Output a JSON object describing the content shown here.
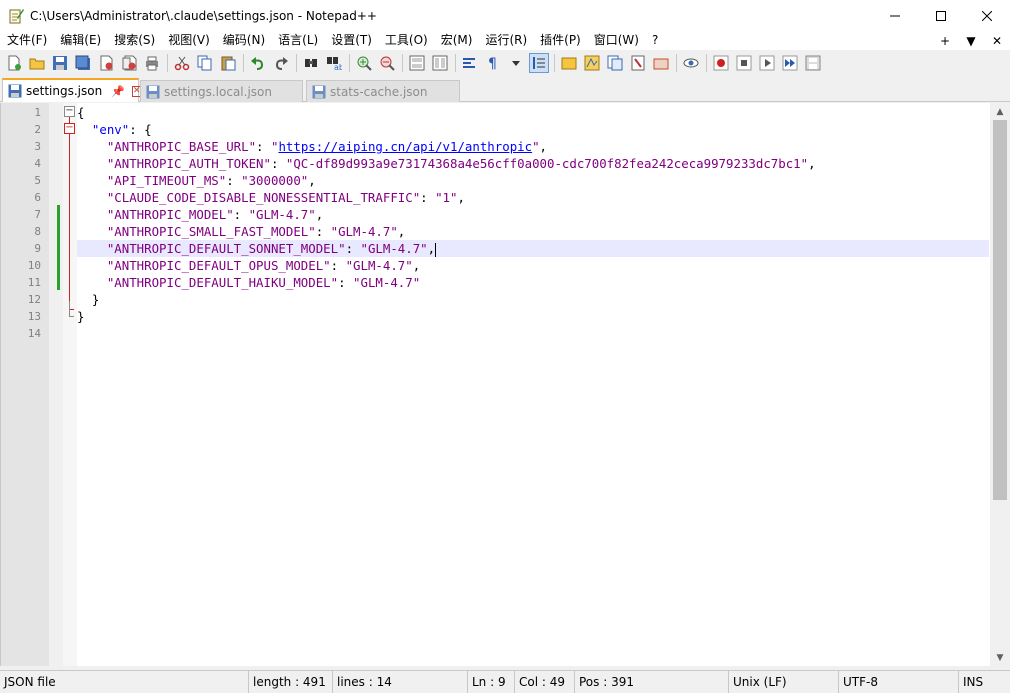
{
  "window": {
    "title": "C:\\Users\\Administrator\\.claude\\settings.json - Notepad++",
    "app_icon": "notepad-icon",
    "controls": [
      "minimize-icon",
      "maximize-icon",
      "close-icon"
    ]
  },
  "menu": {
    "items": [
      "文件(F)",
      "编辑(E)",
      "搜索(S)",
      "视图(V)",
      "编码(N)",
      "语言(L)",
      "设置(T)",
      "工具(O)",
      "宏(M)",
      "运行(R)",
      "插件(P)",
      "窗口(W)",
      "?"
    ],
    "right": [
      "+",
      "▼",
      "✕"
    ]
  },
  "toolbar": {
    "buttons": [
      "new-file-icon",
      "open-file-icon",
      "save-icon",
      "save-all-icon",
      "close-file-icon",
      "close-all-icon",
      "print-icon",
      "cut-icon",
      "copy-icon",
      "paste-icon",
      "undo-icon",
      "redo-icon",
      "find-icon",
      "replace-icon",
      "zoom-in-icon",
      "zoom-out-icon",
      "sync-vertical-icon",
      "sync-horizontal-icon",
      "word-wrap-icon",
      "show-all-chars-icon",
      "indent-guide-icon",
      "dropdown-icon",
      "folder-as-workspace-icon",
      "doc-map-icon",
      "function-list-icon",
      "doc-list-icon",
      "file-browser-icon",
      "monitoring-icon",
      "record-macro-icon",
      "stop-macro-icon",
      "play-macro-icon",
      "run-macro-multiple-icon",
      "save-macro-icon"
    ]
  },
  "tabs": [
    {
      "label": "settings.json",
      "active": true,
      "pin": "📌",
      "close": "✕"
    },
    {
      "label": "settings.local.json",
      "active": false
    },
    {
      "label": "stats-cache.json",
      "active": false
    }
  ],
  "editor": {
    "line_numbers": [
      "1",
      "2",
      "3",
      "4",
      "5",
      "6",
      "7",
      "8",
      "9",
      "10",
      "11",
      "12",
      "13",
      "14"
    ],
    "current_line": 9,
    "lines": [
      [
        {
          "t": "brace",
          "v": "{"
        }
      ],
      [
        {
          "t": "op",
          "v": "  "
        },
        {
          "t": "key2",
          "v": "\"env\""
        },
        {
          "t": "op",
          "v": ": {"
        }
      ],
      [
        {
          "t": "op",
          "v": "    "
        },
        {
          "t": "key",
          "v": "\"ANTHROPIC_BASE_URL\""
        },
        {
          "t": "op",
          "v": ": "
        },
        {
          "t": "str",
          "v": "\""
        },
        {
          "t": "url",
          "v": "https://aiping.cn/api/v1/anthropic"
        },
        {
          "t": "str",
          "v": "\""
        },
        {
          "t": "op",
          "v": ","
        }
      ],
      [
        {
          "t": "op",
          "v": "    "
        },
        {
          "t": "key",
          "v": "\"ANTHROPIC_AUTH_TOKEN\""
        },
        {
          "t": "op",
          "v": ": "
        },
        {
          "t": "str",
          "v": "\"QC-df89d993a9e73174368a4e56cff0a000-cdc700f82fea242ceca9979233dc7bc1\""
        },
        {
          "t": "op",
          "v": ","
        }
      ],
      [
        {
          "t": "op",
          "v": "    "
        },
        {
          "t": "key",
          "v": "\"API_TIMEOUT_MS\""
        },
        {
          "t": "op",
          "v": ": "
        },
        {
          "t": "str",
          "v": "\"3000000\""
        },
        {
          "t": "op",
          "v": ","
        }
      ],
      [
        {
          "t": "op",
          "v": "    "
        },
        {
          "t": "key",
          "v": "\"CLAUDE_CODE_DISABLE_NONESSENTIAL_TRAFFIC\""
        },
        {
          "t": "op",
          "v": ": "
        },
        {
          "t": "str",
          "v": "\"1\""
        },
        {
          "t": "op",
          "v": ","
        }
      ],
      [
        {
          "t": "op",
          "v": "    "
        },
        {
          "t": "key",
          "v": "\"ANTHROPIC_MODEL\""
        },
        {
          "t": "op",
          "v": ": "
        },
        {
          "t": "str",
          "v": "\"GLM-4.7\""
        },
        {
          "t": "op",
          "v": ","
        }
      ],
      [
        {
          "t": "op",
          "v": "    "
        },
        {
          "t": "key",
          "v": "\"ANTHROPIC_SMALL_FAST_MODEL\""
        },
        {
          "t": "op",
          "v": ": "
        },
        {
          "t": "str",
          "v": "\"GLM-4.7\""
        },
        {
          "t": "op",
          "v": ","
        }
      ],
      [
        {
          "t": "op",
          "v": "    "
        },
        {
          "t": "key",
          "v": "\"ANTHROPIC_DEFAULT_SONNET_MODEL\""
        },
        {
          "t": "op",
          "v": ": "
        },
        {
          "t": "str",
          "v": "\"GLM-4.7\""
        },
        {
          "t": "op",
          "v": ","
        },
        {
          "t": "caret",
          "v": ""
        }
      ],
      [
        {
          "t": "op",
          "v": "    "
        },
        {
          "t": "key",
          "v": "\"ANTHROPIC_DEFAULT_OPUS_MODEL\""
        },
        {
          "t": "op",
          "v": ": "
        },
        {
          "t": "str",
          "v": "\"GLM-4.7\""
        },
        {
          "t": "op",
          "v": ","
        }
      ],
      [
        {
          "t": "op",
          "v": "    "
        },
        {
          "t": "key",
          "v": "\"ANTHROPIC_DEFAULT_HAIKU_MODEL\""
        },
        {
          "t": "op",
          "v": ": "
        },
        {
          "t": "str",
          "v": "\"GLM-4.7\""
        }
      ],
      [
        {
          "t": "op",
          "v": "  }"
        }
      ],
      [
        {
          "t": "brace",
          "v": "}"
        }
      ],
      []
    ]
  },
  "status": {
    "file_type": "JSON file",
    "length": "length : 491",
    "lines": "lines : 14",
    "ln": "Ln : 9",
    "col": "Col : 49",
    "pos": "Pos : 391",
    "eol": "Unix (LF)",
    "encoding": "UTF-8",
    "mode": "INS"
  }
}
